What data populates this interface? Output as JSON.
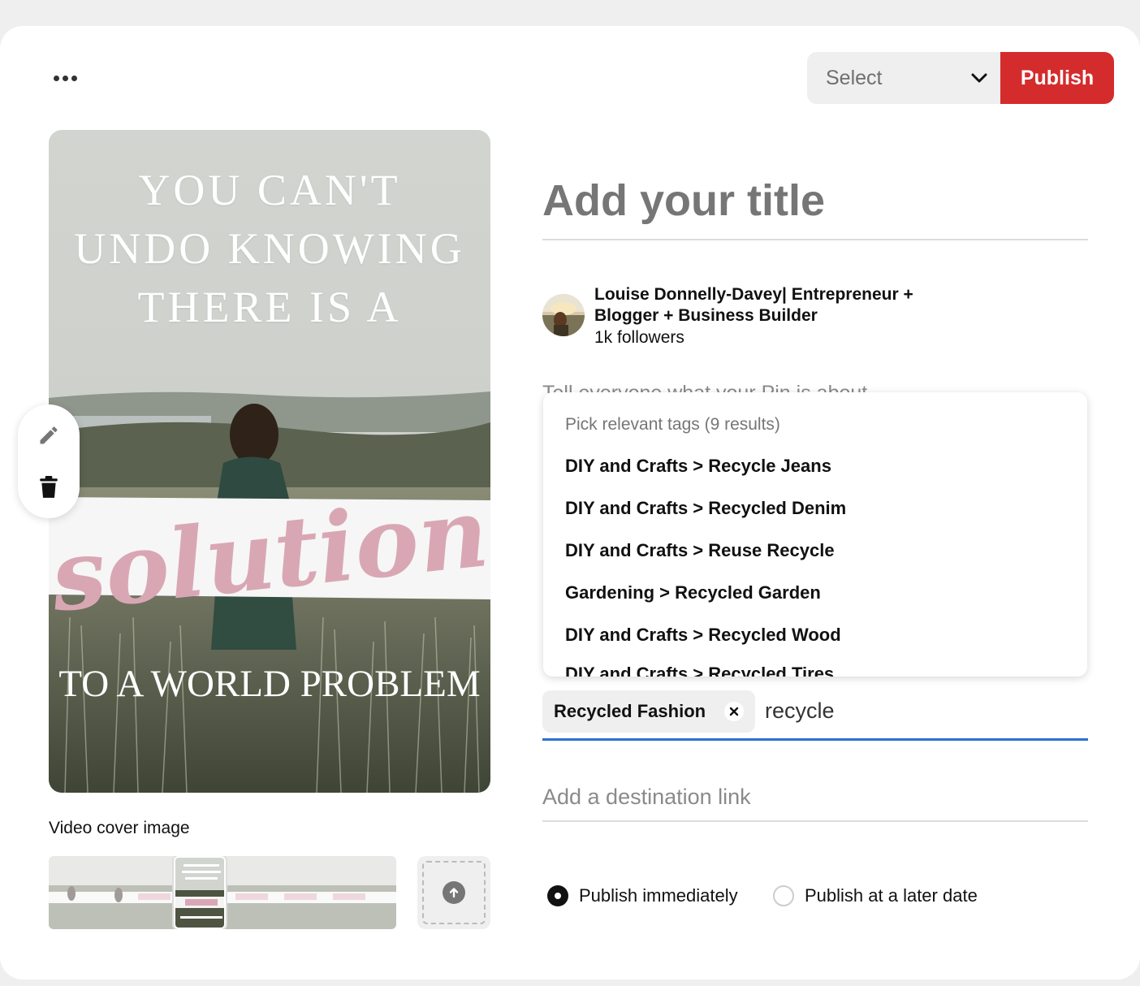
{
  "header": {
    "more_icon": "more-horizontal-icon",
    "board_select": {
      "value": "Select",
      "icon": "chevron-down-icon"
    },
    "publish_label": "Publish",
    "publish_color": "#d42c2c"
  },
  "pin_image": {
    "top_text": [
      "YOU CAN'T",
      "UNDO KNOWING",
      "THERE IS A"
    ],
    "script_text": "solution",
    "bottom_text": "TO A WORLD PROBLEM"
  },
  "edit_tools": [
    {
      "name": "edit",
      "icon": "pencil-icon"
    },
    {
      "name": "delete",
      "icon": "trash-icon"
    }
  ],
  "cover": {
    "label": "Video cover image",
    "upload_icon": "upload-arrow-icon"
  },
  "form": {
    "title_placeholder": "Add your title",
    "user": {
      "name": "Louise Donnelly-Davey| Entrepreneur + Blogger + Business Builder",
      "followers": "1k followers"
    },
    "about_placeholder": "Tell everyone what your Pin is about",
    "tags_dropdown": {
      "header": "Pick relevant tags (9 results)",
      "options": [
        "DIY and Crafts > Recycle Jeans",
        "DIY and Crafts > Recycled Denim",
        "DIY and Crafts > Reuse Recycle",
        "Gardening > Recycled Garden",
        "DIY and Crafts > Recycled Wood",
        "DIY and Crafts > Recycled Tires"
      ]
    },
    "selected_tag": "Recycled Fashion",
    "tag_query": "recycle",
    "destination_placeholder": "Add a destination link",
    "publish_options": [
      {
        "label": "Publish immediately",
        "selected": true
      },
      {
        "label": "Publish at a later date",
        "selected": false
      }
    ],
    "focus_color": "#2f6fd6"
  }
}
